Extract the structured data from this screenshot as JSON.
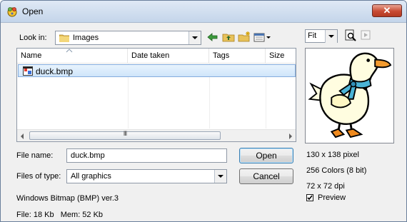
{
  "window": {
    "title": "Open"
  },
  "toolbar": {
    "look_in_label": "Look in:",
    "look_in_value": "Images",
    "fit_value": "Fit"
  },
  "columns": [
    "Name",
    "Date taken",
    "Tags",
    "Size"
  ],
  "files": [
    {
      "name": "duck.bmp"
    }
  ],
  "scrollbar": {
    "grip": "III"
  },
  "form": {
    "file_name_label": "File name:",
    "file_name_value": "duck.bmp",
    "file_type_label": "Files of type:",
    "file_type_value": "All graphics",
    "open_button": "Open",
    "cancel_button": "Cancel"
  },
  "info": {
    "format": "Windows Bitmap (BMP) ver.3",
    "file_mem": "File: 18 Kb   Mem: 52 Kb",
    "dimensions": "130 x 138 pixel",
    "colors": "256 Colors (8 bit)",
    "dpi": "72 x 72 dpi",
    "preview_label": "Preview",
    "preview_checked": true
  },
  "colors": {
    "selection": "#cfe5fa",
    "close_button": "#c84a33",
    "titlebar": "#dfe9f5"
  }
}
